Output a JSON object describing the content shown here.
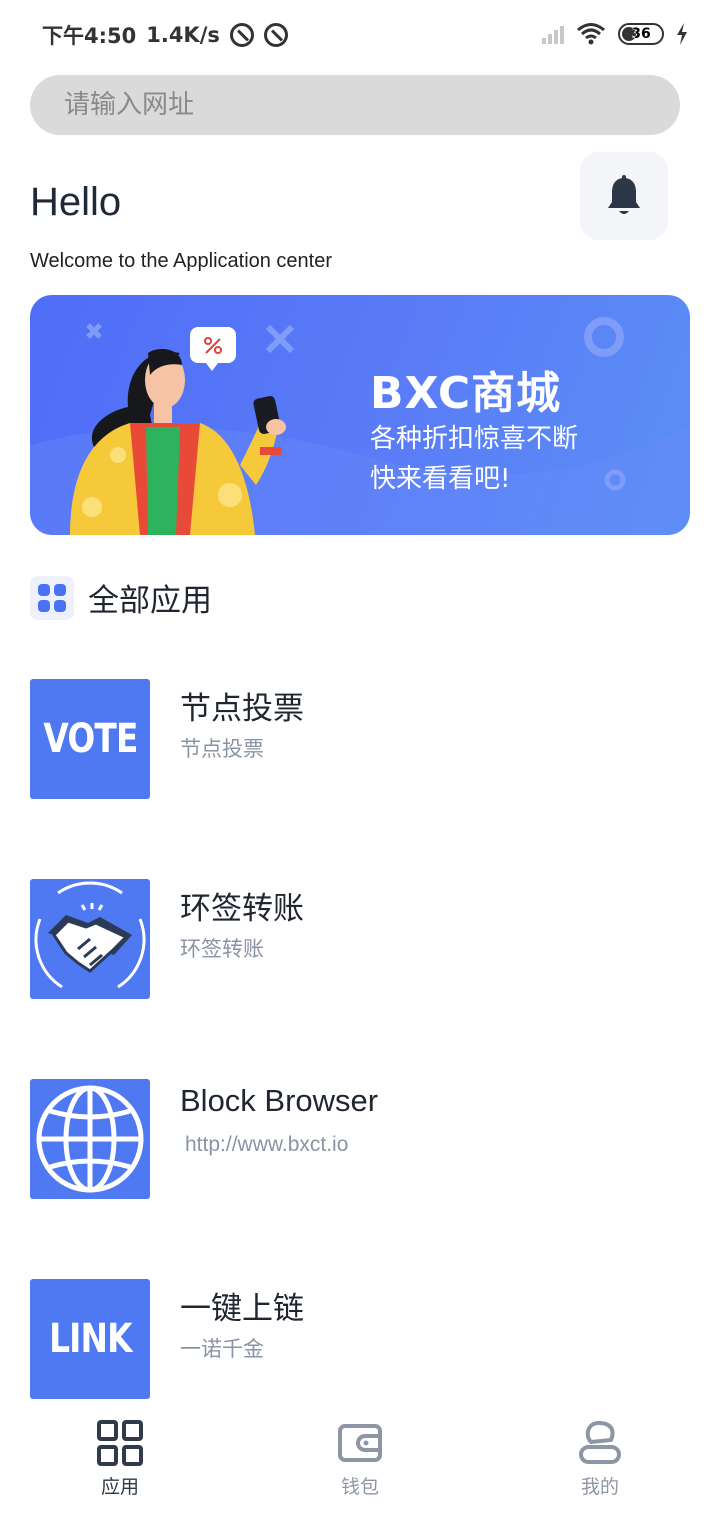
{
  "status_bar": {
    "time": "下午4:50",
    "speed": "1.4K/s",
    "battery": "36"
  },
  "search": {
    "placeholder": "请输入网址"
  },
  "greeting": {
    "title": "Hello",
    "subtitle": "Welcome to the Application center"
  },
  "banner": {
    "title": "BXC商城",
    "line1": "各种折扣惊喜不断",
    "line2": "快来看看吧!"
  },
  "section": {
    "title": "全部应用"
  },
  "apps": [
    {
      "icon": "VOTE",
      "name": "节点投票",
      "desc": "节点投票"
    },
    {
      "icon": "handshake-icon",
      "name": "环签转账",
      "desc": "环签转账"
    },
    {
      "icon": "globe-icon",
      "name": "Block Browser",
      "desc": "http://www.bxct.io"
    },
    {
      "icon": "LINK",
      "name": "一键上链",
      "desc": "一诺千金"
    }
  ],
  "nav": {
    "items": [
      {
        "label": "应用",
        "active": true
      },
      {
        "label": "钱包",
        "active": false
      },
      {
        "label": "我的",
        "active": false
      }
    ],
    "active_color": "#2f3a4a",
    "inactive_color": "#8d96a5"
  },
  "colors": {
    "accent": "#4f79f3",
    "banner": "#5a7cf7"
  }
}
